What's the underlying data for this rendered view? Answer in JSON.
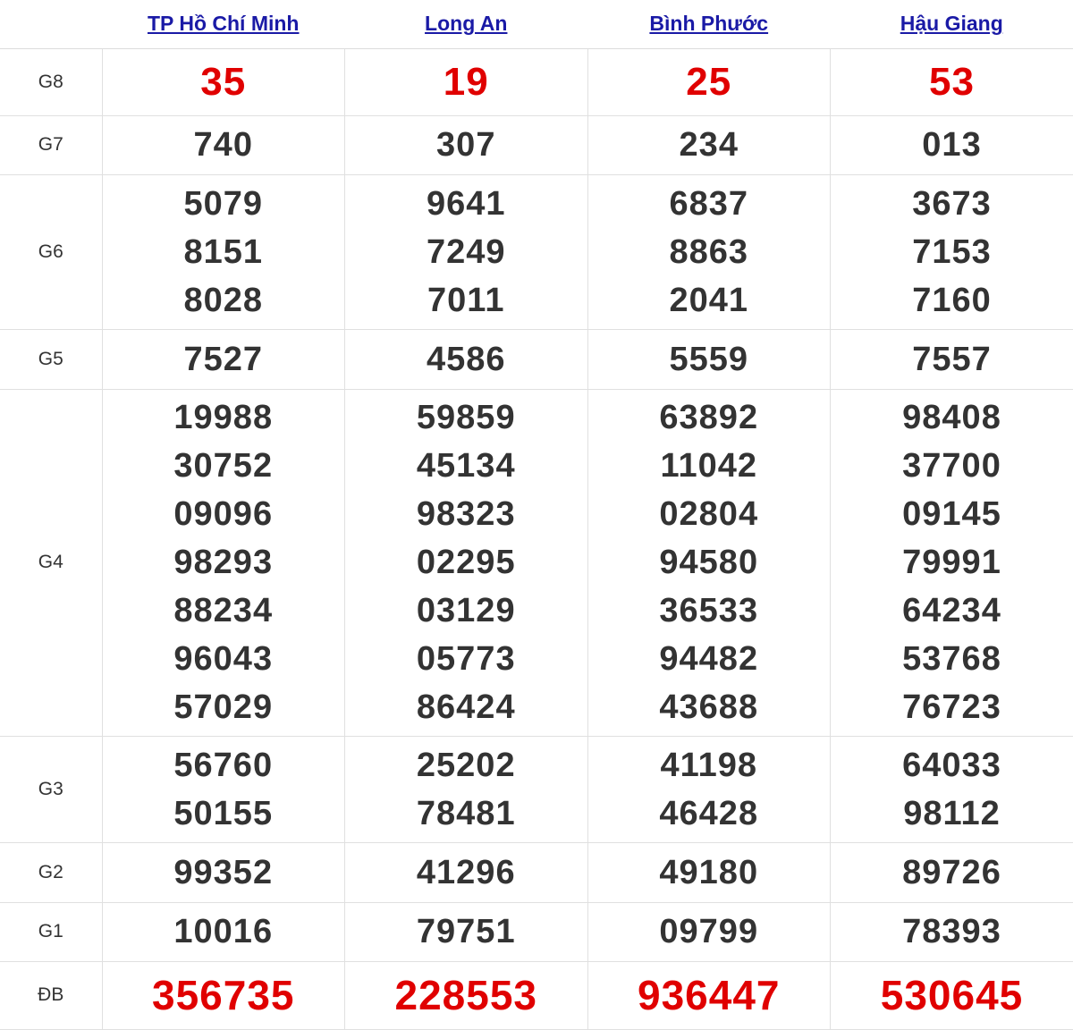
{
  "provinces": [
    "TP Hồ Chí Minh",
    "Long An",
    "Bình Phước",
    "Hậu Giang"
  ],
  "prizes": [
    {
      "label": "G8",
      "values": [
        [
          "35"
        ],
        [
          "19"
        ],
        [
          "25"
        ],
        [
          "53"
        ]
      ]
    },
    {
      "label": "G7",
      "values": [
        [
          "740"
        ],
        [
          "307"
        ],
        [
          "234"
        ],
        [
          "013"
        ]
      ]
    },
    {
      "label": "G6",
      "values": [
        [
          "5079",
          "8151",
          "8028"
        ],
        [
          "9641",
          "7249",
          "7011"
        ],
        [
          "6837",
          "8863",
          "2041"
        ],
        [
          "3673",
          "7153",
          "7160"
        ]
      ]
    },
    {
      "label": "G5",
      "values": [
        [
          "7527"
        ],
        [
          "4586"
        ],
        [
          "5559"
        ],
        [
          "7557"
        ]
      ]
    },
    {
      "label": "G4",
      "values": [
        [
          "19988",
          "30752",
          "09096",
          "98293",
          "88234",
          "96043",
          "57029"
        ],
        [
          "59859",
          "45134",
          "98323",
          "02295",
          "03129",
          "05773",
          "86424"
        ],
        [
          "63892",
          "11042",
          "02804",
          "94580",
          "36533",
          "94482",
          "43688"
        ],
        [
          "98408",
          "37700",
          "09145",
          "79991",
          "64234",
          "53768",
          "76723"
        ]
      ]
    },
    {
      "label": "G3",
      "values": [
        [
          "56760",
          "50155"
        ],
        [
          "25202",
          "78481"
        ],
        [
          "41198",
          "46428"
        ],
        [
          "64033",
          "98112"
        ]
      ]
    },
    {
      "label": "G2",
      "values": [
        [
          "99352"
        ],
        [
          "41296"
        ],
        [
          "49180"
        ],
        [
          "89726"
        ]
      ]
    },
    {
      "label": "G1",
      "values": [
        [
          "10016"
        ],
        [
          "79751"
        ],
        [
          "09799"
        ],
        [
          "78393"
        ]
      ]
    },
    {
      "label": "ĐB",
      "values": [
        [
          "356735"
        ],
        [
          "228553"
        ],
        [
          "936447"
        ],
        [
          "530645"
        ]
      ]
    }
  ],
  "colors": {
    "link": "#1a1aa6",
    "highlight": "#e00000",
    "text": "#333333",
    "border": "#e0e0e0"
  }
}
